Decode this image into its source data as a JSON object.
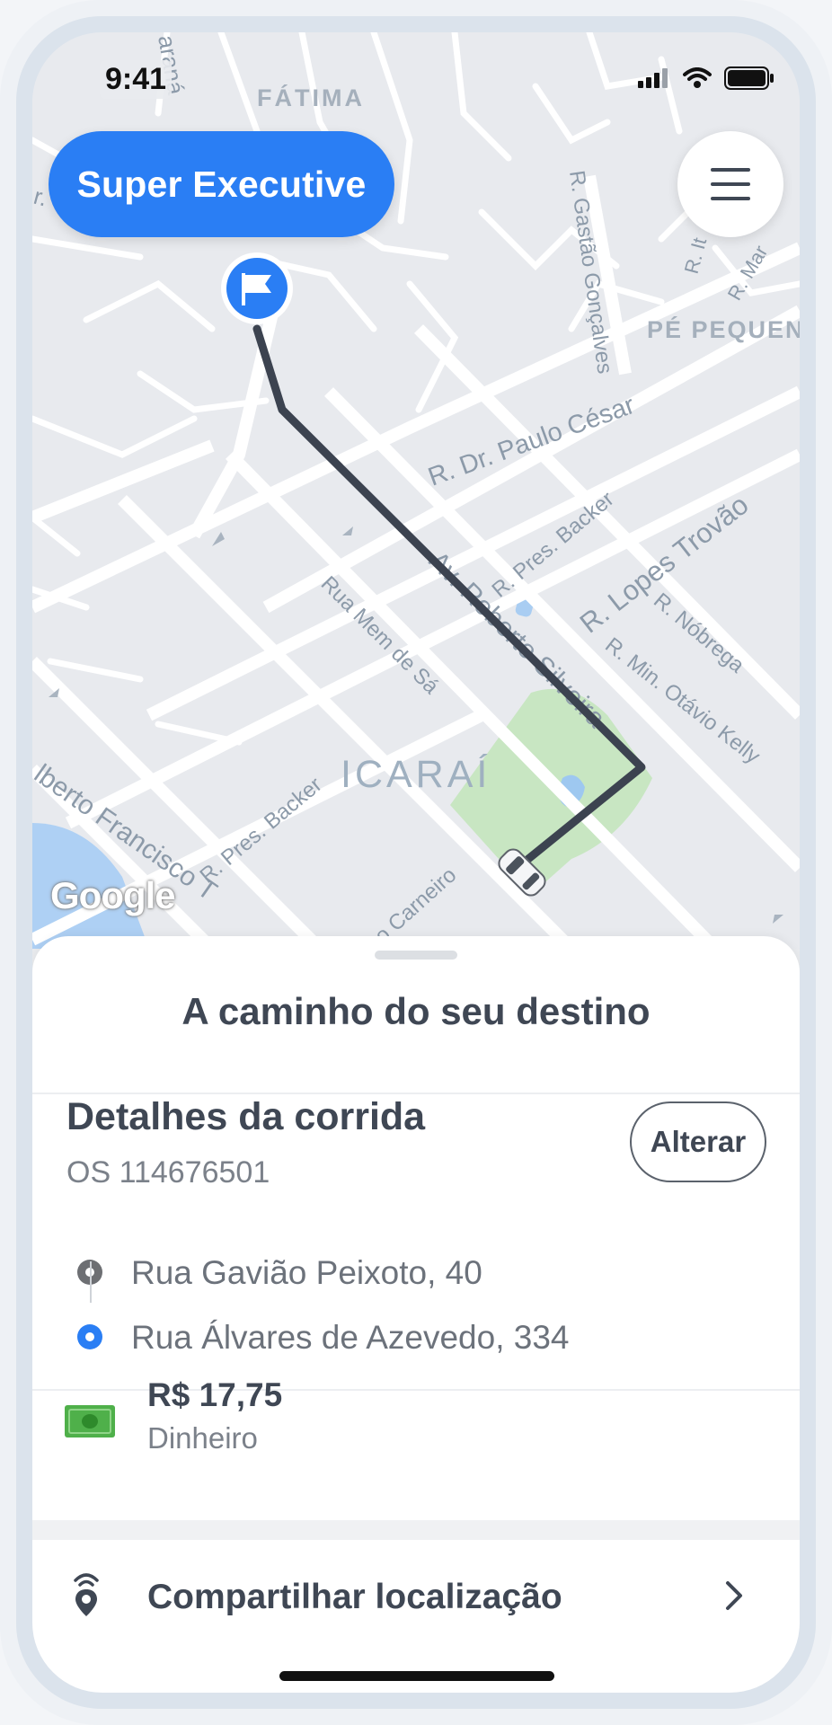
{
  "status_bar": {
    "time": "9:41",
    "icons": [
      "cellular-signal-icon",
      "wifi-icon",
      "battery-icon"
    ]
  },
  "map": {
    "labels": {
      "fatima": "FÁTIMA",
      "parana_fragment": "araná",
      "r_fragment": "r.",
      "gastao": "R. Gastão Gonçalves",
      "pe_pequeno": "PÉ PEQUEN",
      "it_fragment": "R. It",
      "mar_fragment": "R. Mar",
      "paulo_cesar": "R. Dr. Paulo César",
      "lopes_trovao": "R. Lopes Trovão",
      "nobrega": "R. Nóbrega",
      "otavio_kelly": "R. Min. Otávio Kelly",
      "pres_backer_top": "R. Pres. Backer",
      "roberto_silveira": "Av. Roberto Silveira",
      "mem_de_sa": "Rua Mem de Sá",
      "icarai": "ICARAÍ",
      "pres_backer_bottom": "R. Pres. Backer",
      "alberto_francisco": "lberto Francisco T",
      "carneiro": "o Carneiro"
    },
    "google_logo_text": "Google",
    "route_color": "#3c4350",
    "flag_marker_icon": "flag-icon",
    "car_marker_icon": "car-icon"
  },
  "service": {
    "label": "Super Executive",
    "color": "#2a7ef4"
  },
  "menu_icon": "hamburger-menu-icon",
  "sheet": {
    "title": "A caminho do seu destino",
    "details": {
      "title": "Detalhes da corrida",
      "order_number": "OS 114676501",
      "change_label": "Alterar",
      "origin": "Rua Gavião Peixoto, 40",
      "destination": "Rua Álvares de Azevedo, 334",
      "origin_dot_color": "#6d6f73",
      "destination_dot_color": "#2a7ef4"
    },
    "payment": {
      "amount": "R$ 17,75",
      "method": "Dinheiro",
      "icon": "cash-icon"
    },
    "share": {
      "label": "Compartilhar localização",
      "icon": "share-location-icon"
    }
  }
}
